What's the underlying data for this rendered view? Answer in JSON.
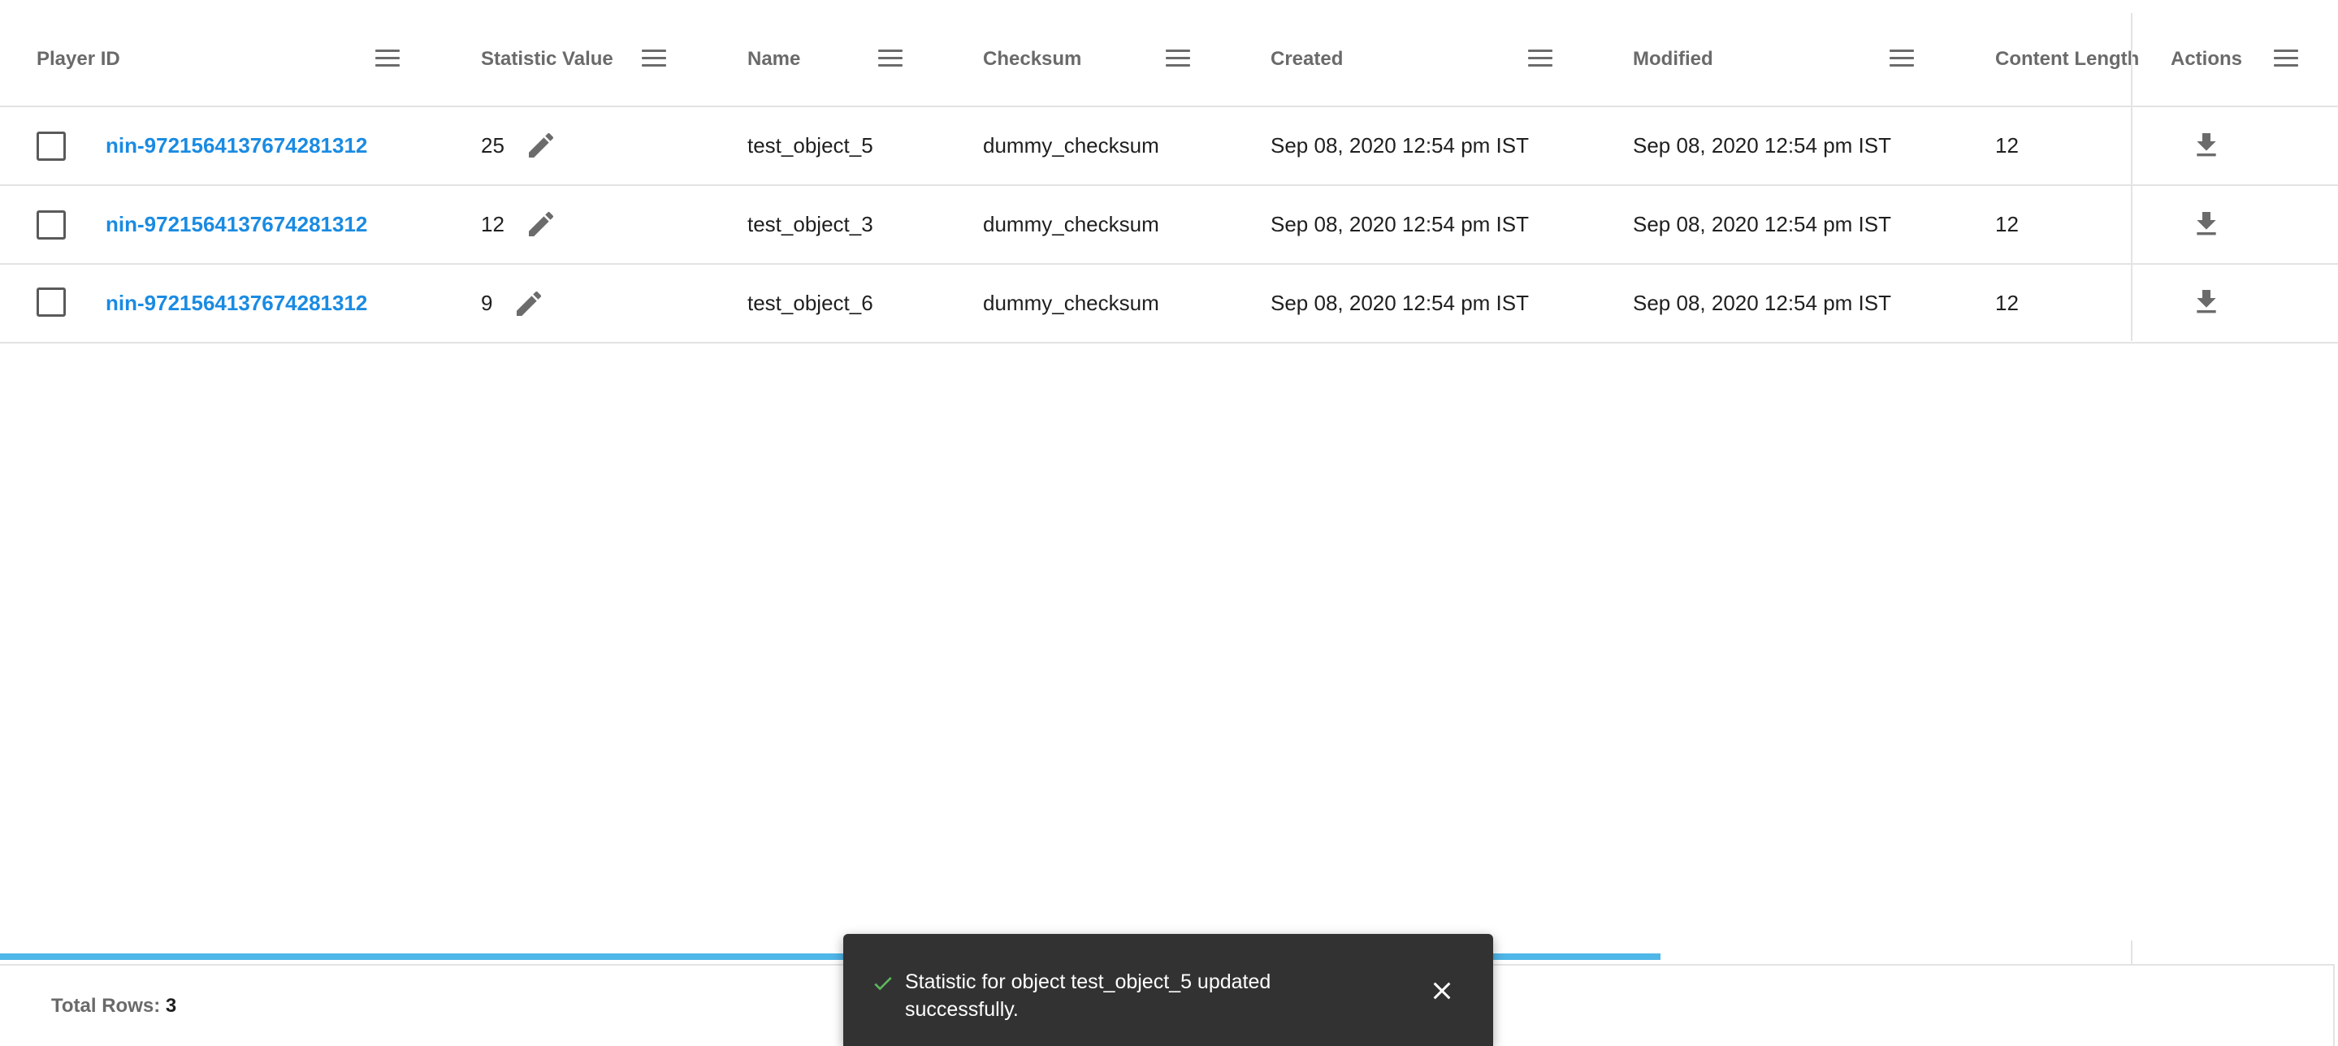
{
  "columns": [
    {
      "label": "Player ID"
    },
    {
      "label": "Statistic Value"
    },
    {
      "label": "Name"
    },
    {
      "label": "Checksum"
    },
    {
      "label": "Created"
    },
    {
      "label": "Modified"
    },
    {
      "label": "Content Length"
    },
    {
      "label": "Actions"
    }
  ],
  "rows": [
    {
      "player_id": "nin-9721564137674281312",
      "statistic_value": "25",
      "name": "test_object_5",
      "checksum": "dummy_checksum",
      "created": "Sep 08, 2020 12:54 pm IST",
      "modified": "Sep 08, 2020 12:54 pm IST",
      "content_length": "12"
    },
    {
      "player_id": "nin-9721564137674281312",
      "statistic_value": "12",
      "name": "test_object_3",
      "checksum": "dummy_checksum",
      "created": "Sep 08, 2020 12:54 pm IST",
      "modified": "Sep 08, 2020 12:54 pm IST",
      "content_length": "12"
    },
    {
      "player_id": "nin-9721564137674281312",
      "statistic_value": "9",
      "name": "test_object_6",
      "checksum": "dummy_checksum",
      "created": "Sep 08, 2020 12:54 pm IST",
      "modified": "Sep 08, 2020 12:54 pm IST",
      "content_length": "12"
    }
  ],
  "footer": {
    "total_rows_label": "Total Rows:",
    "total_rows_value": "3"
  },
  "snackbar": {
    "message": "Statistic for object test_object_5 updated successfully."
  },
  "icons": {
    "column_menu": "hamburger-menu-icon",
    "edit": "pencil-icon",
    "download": "download-icon",
    "success": "checkmark-icon",
    "close": "close-icon"
  },
  "colors": {
    "link": "#1a8be2",
    "progress": "#4fb6e8",
    "snackbar_bg": "#323232",
    "success_check": "#5cb85c"
  }
}
